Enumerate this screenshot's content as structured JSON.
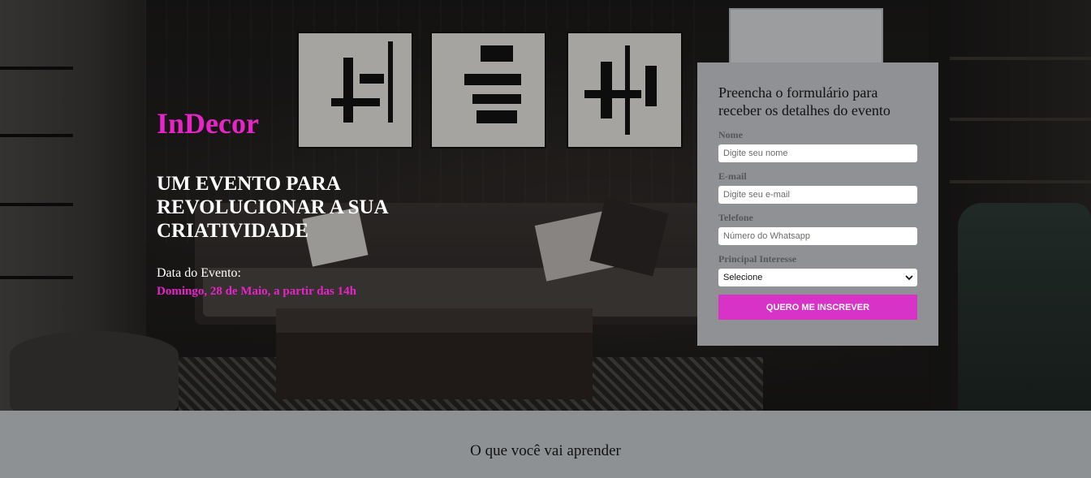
{
  "hero": {
    "brand": "InDecor",
    "headline": "UM EVENTO PARA REVOLUCIONAR A SUA CRIATIVIDADE",
    "event_label": "Data do Evento:",
    "event_date": "Domingo, 28 de Maio, a partir das 14h"
  },
  "form": {
    "title": "Preencha o formulário para receber os detalhes do evento",
    "name_label": "Nome",
    "name_placeholder": "Digite seu nome",
    "email_label": "E-mail",
    "email_placeholder": "Digite seu e-mail",
    "phone_label": "Telefone",
    "phone_placeholder": "Número do Whatsapp",
    "interest_label": "Principal Interesse",
    "interest_selected": "Selecione",
    "submit_label": "QUERO ME INSCREVER"
  },
  "section": {
    "title": "O que você vai aprender"
  },
  "colors": {
    "accent": "#e624c8",
    "button": "#d733c6",
    "panel": "#8f9194"
  },
  "icons": {
    "select_arrow": "chevron-down-icon"
  }
}
